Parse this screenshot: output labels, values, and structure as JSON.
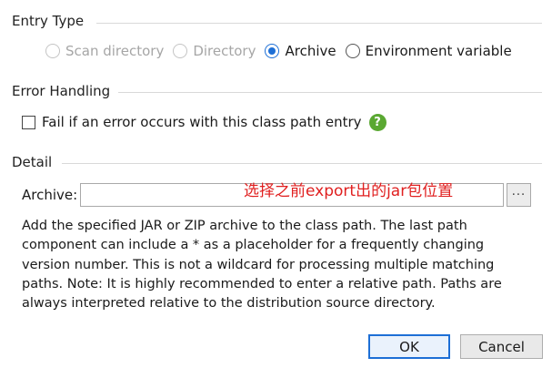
{
  "entry_type": {
    "title": "Entry Type",
    "options": [
      {
        "label": "Scan directory",
        "state": "disabled"
      },
      {
        "label": "Directory",
        "state": "disabled"
      },
      {
        "label": "Archive",
        "state": "checked"
      },
      {
        "label": "Environment variable",
        "state": "enabled"
      }
    ]
  },
  "error_handling": {
    "title": "Error Handling",
    "checkbox_label": "Fail if an error occurs with this class path entry",
    "checked": false,
    "help_icon": "?"
  },
  "detail": {
    "title": "Detail",
    "archive_label": "Archive:",
    "archive_value": "",
    "browse_label": "···",
    "annotation": "选择之前export出的jar包位置",
    "description": "Add the specified JAR or ZIP archive to the class path. The last path component can include a * as a placeholder for a frequently changing version number. This is not a wildcard for processing multiple matching paths. Note: It is highly recommended to enter a relative path. Paths are always interpreted relative to the distribution source directory."
  },
  "buttons": {
    "ok": "OK",
    "cancel": "Cancel"
  },
  "colors": {
    "accent": "#1d6fd6",
    "help_green": "#5aa832",
    "annotation_red": "#e02020"
  }
}
